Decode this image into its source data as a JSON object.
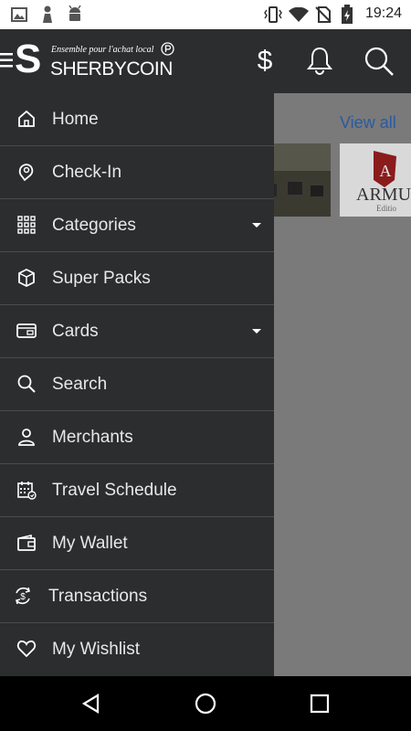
{
  "status_bar": {
    "time": "19:24",
    "icons": [
      "image-icon",
      "notification-icon",
      "android-icon",
      "vibrate-icon",
      "wifi-icon",
      "no-sim-icon",
      "battery-icon"
    ]
  },
  "app_bar": {
    "logo_letter": "S",
    "tagline": "Ensemble pour l'achat local",
    "brand": "SHERBYCOIN",
    "actions": [
      "dollar-icon",
      "bell-icon",
      "search-icon"
    ]
  },
  "background": {
    "view_all": "View all"
  },
  "drawer": {
    "items": [
      {
        "label": "Home",
        "icon": "home-icon"
      },
      {
        "label": "Check-In",
        "icon": "map-pin-icon"
      },
      {
        "label": "Categories",
        "icon": "grid-icon",
        "expandable": true
      },
      {
        "label": "Super Packs",
        "icon": "box-icon"
      },
      {
        "label": "Cards",
        "icon": "card-icon",
        "expandable": true
      },
      {
        "label": "Search",
        "icon": "search-icon"
      },
      {
        "label": "Merchants",
        "icon": "person-icon"
      },
      {
        "label": "Travel Schedule",
        "icon": "calendar-icon"
      },
      {
        "label": "My Wallet",
        "icon": "wallet-icon"
      },
      {
        "label": "Transactions",
        "icon": "dollar-cycle-icon"
      },
      {
        "label": "My Wishlist",
        "icon": "heart-icon"
      }
    ]
  },
  "colors": {
    "drawer_bg": "#2b2d2e",
    "divider": "#4a4c4d",
    "text": "#e8e8e8",
    "link": "#2a5aa0",
    "scrim": "#7a7a7a"
  }
}
